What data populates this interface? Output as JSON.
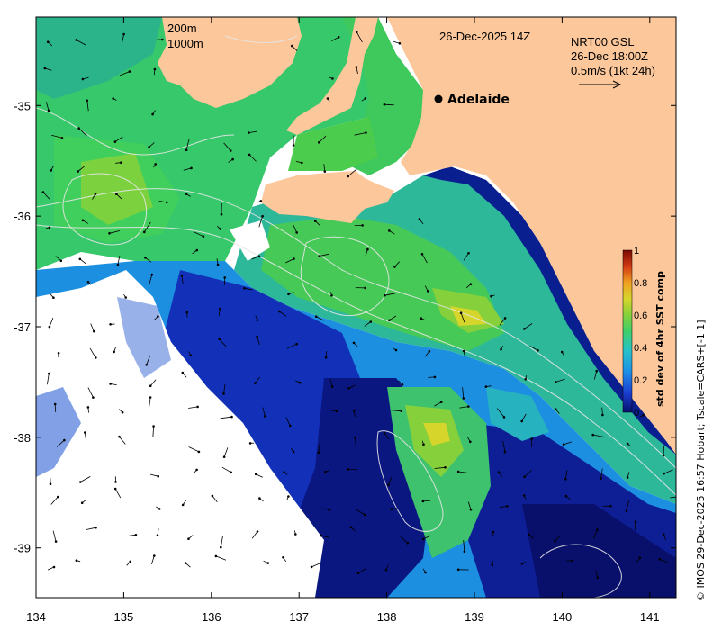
{
  "header": {
    "date": "26-Dec-2025 14Z",
    "product": "NRT00 GSL",
    "product_time": "26-Dec 18:00Z",
    "vector_scale": "0.5m/s (1kt 24h)",
    "isobath_200": "200m",
    "isobath_1000": "1000m"
  },
  "place": {
    "name": "Adelaide",
    "lon": 138.6,
    "lat": -34.93
  },
  "axes": {
    "x_ticks": [
      "134",
      "135",
      "136",
      "137",
      "138",
      "139",
      "140",
      "141"
    ],
    "y_ticks": [
      "-35",
      "-36",
      "-37",
      "-38",
      "-39"
    ],
    "xlim": [
      134,
      141.3
    ],
    "ylim": [
      -39.45,
      -34.2
    ]
  },
  "colorbar": {
    "label": "std dev of 4hr SST comp",
    "ticks": [
      "0",
      "0.2",
      "0.4",
      "0.6",
      "0.8",
      "1"
    ],
    "colors": [
      "#08106b",
      "#1a3fd1",
      "#1e8fe6",
      "#27c2c9",
      "#3ecf6a",
      "#86d13b",
      "#d6d52c",
      "#f0a020",
      "#d23a12",
      "#7a0a05"
    ]
  },
  "credit": "© IMOS 29-Dec-2025 16:57 Hobart; Tscale=CARS+[-1 1]",
  "colors": {
    "land": "#fcc79a",
    "no_data": "#ffffff",
    "contour": "#e6e6e6",
    "arrow": "#000000"
  }
}
